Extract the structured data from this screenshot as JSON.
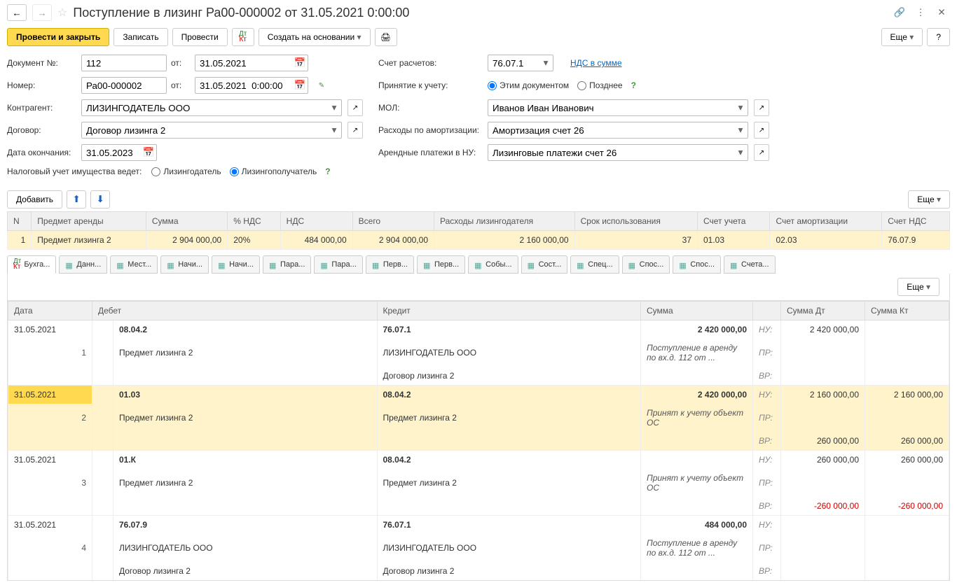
{
  "header": {
    "title": "Поступление в лизинг Ра00-000002 от 31.05.2021 0:00:00"
  },
  "toolbar": {
    "post_close": "Провести и закрыть",
    "save": "Записать",
    "post": "Провести",
    "create_based": "Создать на основании",
    "more": "Еще",
    "help": "?"
  },
  "form": {
    "doc_no_label": "Документ №:",
    "doc_no": "112",
    "from_label": "от:",
    "doc_date": "31.05.2021",
    "number_label": "Номер:",
    "number": "Ра00-000002",
    "number_date": "31.05.2021  0:00:00",
    "contragent_label": "Контрагент:",
    "contragent": "ЛИЗИНГОДАТЕЛЬ ООО",
    "contract_label": "Договор:",
    "contract": "Договор лизинга 2",
    "end_date_label": "Дата окончания:",
    "end_date": "31.05.2023",
    "tax_label": "Налоговый учет имущества ведет:",
    "tax_opt1": "Лизингодатель",
    "tax_opt2": "Лизингополучатель",
    "account_label": "Счет расчетов:",
    "account": "76.07.1",
    "vat_link": "НДС в сумме",
    "accept_label": "Принятие к учету:",
    "accept_opt1": "Этим документом",
    "accept_opt2": "Позднее",
    "mol_label": "МОЛ:",
    "mol": "Иванов Иван Иванович",
    "deprec_label": "Расходы по амортизации:",
    "deprec": "Амортизация счет 26",
    "rent_label": "Арендные платежи в НУ:",
    "rent": "Лизинговые платежи счет 26"
  },
  "items_toolbar": {
    "add": "Добавить",
    "more": "Еще"
  },
  "items_columns": {
    "n": "N",
    "subject": "Предмет аренды",
    "sum": "Сумма",
    "vat_pct": "% НДС",
    "vat": "НДС",
    "total": "Всего",
    "lessor_exp": "Расходы лизингодателя",
    "use_period": "Срок использования",
    "acct": "Счет учета",
    "deprec_acct": "Счет амортизации",
    "vat_acct": "Счет НДС"
  },
  "items_rows": [
    {
      "n": "1",
      "subject": "Предмет лизинга 2",
      "sum": "2 904 000,00",
      "vat_pct": "20%",
      "vat": "484 000,00",
      "total": "2 904 000,00",
      "lessor_exp": "2 160 000,00",
      "use_period": "37",
      "acct": "01.03",
      "deprec_acct": "02.03",
      "vat_acct": "76.07.9"
    }
  ],
  "tabs": [
    "Бухга...",
    "Данн...",
    "Мест...",
    "Начи...",
    "Начи...",
    "Пара...",
    "Пара...",
    "Перв...",
    "Перв...",
    "Собы...",
    "Сост...",
    "Спец...",
    "Спос...",
    "Спос...",
    "Счета..."
  ],
  "ledger_columns": {
    "date": "Дата",
    "debit": "Дебет",
    "credit": "Кредит",
    "sum": "Сумма",
    "sum_dt": "Сумма Дт",
    "sum_kt": "Сумма Кт"
  },
  "ledger": [
    {
      "hl": false,
      "date": "31.05.2021",
      "n": "1",
      "debit_acc": "08.04.2",
      "debit_1": "Предмет лизинга 2",
      "debit_2": "",
      "credit_acc": "76.07.1",
      "credit_1": "ЛИЗИНГОДАТЕЛЬ ООО",
      "credit_2": "Договор лизинга 2",
      "sum": "2 420 000,00",
      "desc": "Поступление в аренду по вх.д. 112 от ...",
      "nu_dt": "2 420 000,00",
      "nu_kt": "",
      "pr_dt": "",
      "pr_kt": "",
      "vr_dt": "",
      "vr_kt": ""
    },
    {
      "hl": true,
      "date": "31.05.2021",
      "n": "2",
      "debit_acc": "01.03",
      "debit_1": "Предмет лизинга 2",
      "debit_2": "",
      "credit_acc": "08.04.2",
      "credit_1": "Предмет лизинга 2",
      "credit_2": "",
      "sum": "2 420 000,00",
      "desc": "Принят к учету объект ОС",
      "nu_dt": "2 160 000,00",
      "nu_kt": "2 160 000,00",
      "pr_dt": "",
      "pr_kt": "",
      "vr_dt": "260 000,00",
      "vr_kt": "260 000,00"
    },
    {
      "hl": false,
      "date": "31.05.2021",
      "n": "3",
      "debit_acc": "01.К",
      "debit_1": "Предмет лизинга 2",
      "debit_2": "",
      "credit_acc": "08.04.2",
      "credit_1": "Предмет лизинга 2",
      "credit_2": "",
      "sum": "",
      "desc": "Принят к учету объект ОС",
      "nu_dt": "260 000,00",
      "nu_kt": "260 000,00",
      "pr_dt": "",
      "pr_kt": "",
      "vr_dt": "-260 000,00",
      "vr_kt": "-260 000,00",
      "vr_red": true
    },
    {
      "hl": false,
      "date": "31.05.2021",
      "n": "4",
      "debit_acc": "76.07.9",
      "debit_1": "ЛИЗИНГОДАТЕЛЬ ООО",
      "debit_2": "Договор лизинга 2",
      "credit_acc": "76.07.1",
      "credit_1": "ЛИЗИНГОДАТЕЛЬ ООО",
      "credit_2": "Договор лизинга 2",
      "sum": "484 000,00",
      "desc": "Поступление в аренду по вх.д. 112 от ...",
      "nu_dt": "",
      "nu_kt": "",
      "pr_dt": "",
      "pr_kt": "",
      "vr_dt": "",
      "vr_kt": ""
    }
  ],
  "labels": {
    "nu": "НУ:",
    "pr": "ПР:",
    "vr": "ВР:"
  }
}
